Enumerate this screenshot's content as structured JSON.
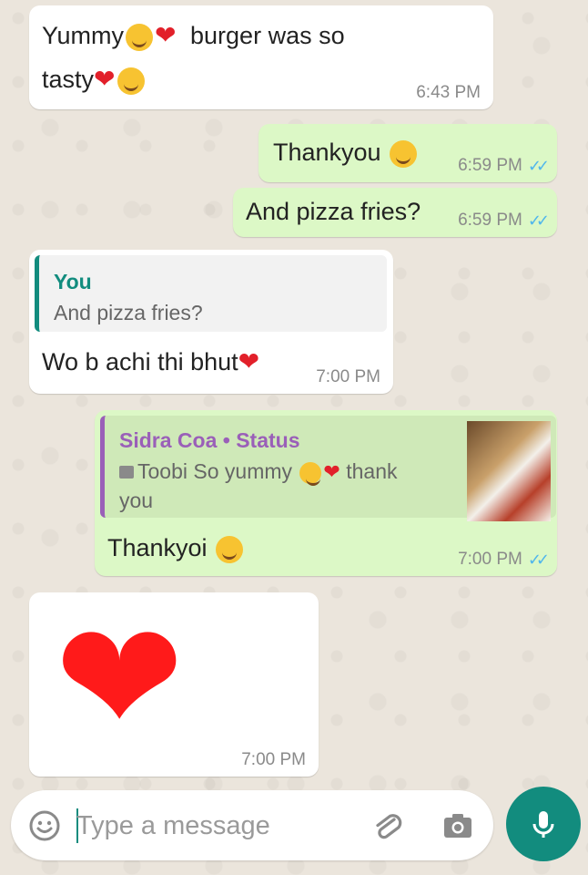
{
  "messages": [
    {
      "text_line1": "Yummy",
      "text_line1b": "burger was so",
      "text_line2": "tasty",
      "time": "6:43 PM"
    },
    {
      "text": "Thankyou",
      "time": "6:59 PM"
    },
    {
      "text": "And pizza fries?",
      "time": "6:59 PM"
    },
    {
      "quote_author": "You",
      "quote_text": "And pizza fries?",
      "text": "Wo b achi thi bhut",
      "time": "7:00 PM"
    },
    {
      "quote_author": "Sidra Coa • Status",
      "quote_text_a": "Toobi So yummy",
      "quote_text_b": "thank",
      "quote_text_c": "you",
      "text": "Thankyoi",
      "time": "7:00 PM"
    },
    {
      "time": "7:00 PM"
    }
  ],
  "composer": {
    "placeholder": "Type a message"
  },
  "colors": {
    "incoming": "#ffffff",
    "outgoing": "#dcf8c6",
    "accent": "#128c7e",
    "read_ticks": "#4fb6ec"
  },
  "icons": [
    "smiley-icon",
    "attachment-icon",
    "camera-icon",
    "microphone-icon",
    "double-check-icon",
    "heart-icon",
    "smiling-hearts-face-icon",
    "image-icon"
  ]
}
